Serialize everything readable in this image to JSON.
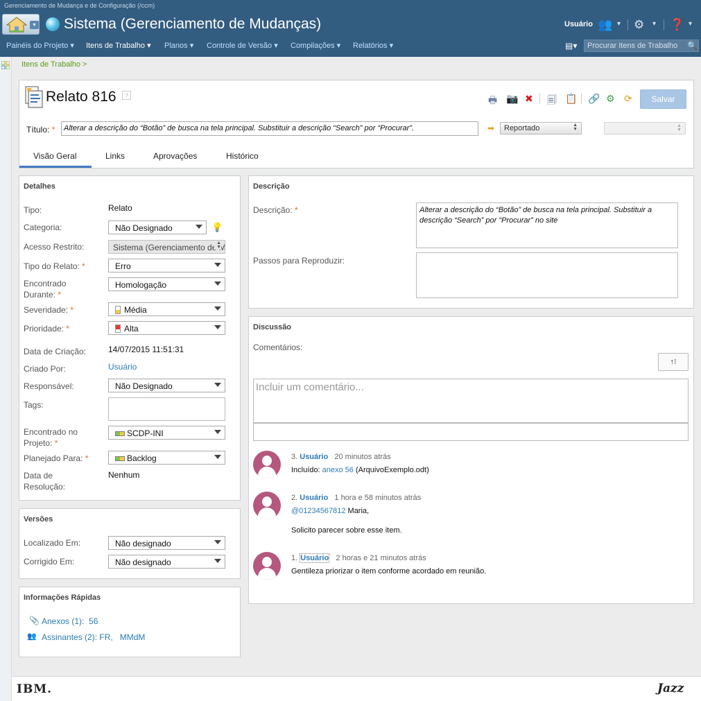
{
  "app": {
    "title": "Gerenciamento de Mudança e de Configuração (/ccm)",
    "project_title": "Sistema (Gerenciamento de Mudanças)",
    "user_label": "Usuário"
  },
  "menu": [
    {
      "label": "Painéis do Projeto"
    },
    {
      "label": "Itens de Trabalho"
    },
    {
      "label": "Planos"
    },
    {
      "label": "Controle de Versão"
    },
    {
      "label": "Compilações"
    },
    {
      "label": "Relatórios"
    }
  ],
  "search": {
    "placeholder": "Procurar Itens de Trabalho"
  },
  "breadcrumb": "Itens de Trabalho >",
  "workitem": {
    "title": "Relato 816",
    "save_label": "Salvar",
    "title_label": "Título:",
    "title_value": "Alterar a descrição do “Botão” de busca na tela principal. Substituir a descrição “Search” por “Procurar”.",
    "state": "Reportado"
  },
  "tabs": [
    {
      "label": "Visão Geral"
    },
    {
      "label": "Links"
    },
    {
      "label": "Aprovações"
    },
    {
      "label": "Histórico"
    }
  ],
  "details": {
    "heading": "Detalhes",
    "tipo_label": "Tipo:",
    "tipo": "Relato",
    "categoria_label": "Categoria:",
    "categoria": "Não Designado",
    "acesso_label": "Acesso Restrito:",
    "acesso": "Sistema (Gerenciamento de Mudanças)",
    "tipo_relato_label": "Tipo do Relato:",
    "tipo_relato": "Erro",
    "encontrado_durante_label_1": "Encontrado",
    "encontrado_durante_label_2": "Durante:",
    "encontrado_durante": "Homologação",
    "severidade_label": "Severidade:",
    "severidade": "Média",
    "prioridade_label": "Prioridade:",
    "prioridade": "Alta",
    "data_criacao_label": "Data de Criação:",
    "data_criacao": "14/07/2015 11:51:31",
    "criado_por_label": "Criado Por:",
    "criado_por": "Usuário",
    "responsavel_label": "Responsável:",
    "responsavel": "Não Designado",
    "tags_label": "Tags:",
    "encontrado_projeto_label_1": "Encontrado no",
    "encontrado_projeto_label_2": "Projeto:",
    "encontrado_projeto": "SCDP-INI",
    "planejado_label": "Planejado Para:",
    "planejado": "Backlog",
    "data_resolucao_label_1": "Data de",
    "data_resolucao_label_2": "Resolução:",
    "data_resolucao": "Nenhum"
  },
  "versions": {
    "heading": "Versões",
    "localizado_label": "Localizado Em:",
    "localizado": "Não designado",
    "corrigido_label": "Corrigido Em:",
    "corrigido": "Não designado"
  },
  "quickinfo": {
    "heading": "Informações Rápidas",
    "anexos_label": "Anexos (1):",
    "anexos_value": "56",
    "assinantes_label": "Assinantes (2):",
    "assinante_1": "FR,",
    "assinante_2": "MMdM"
  },
  "description": {
    "heading": "Descrição",
    "desc_label": "Descrição:",
    "desc_value": "Alterar a descrição do “Botão” de busca na tela principal. Substituir a descrição “Search” por “Procurar” no site",
    "steps_label": "Passos para Reproduzir:"
  },
  "discussion": {
    "heading": "Discussão",
    "comments_label": "Comentários:",
    "comment_placeholder": "Incluir um comentário...",
    "comments": [
      {
        "num": "3.",
        "author": "Usuário",
        "time": "20 minutos atrás",
        "prefix": "Incluído:",
        "link": "anexo 56",
        "suffix": "(ArquivoExemplo.odt)"
      },
      {
        "num": "2.",
        "author": "Usuário",
        "time": "1 hora e 58 minutos atrás",
        "mention": "@01234567812",
        "line1_rest": "Maria,",
        "line2": "Solicito parecer sobre esse item."
      },
      {
        "num": "1.",
        "author": "Usuário",
        "time": "2 horas e 21 minutos atrás",
        "text": "Gentileza priorizar o item conforme acordado em reunião."
      }
    ]
  },
  "footer": {
    "ibm": "IBM.",
    "jazz": "Jazz"
  },
  "colors": {
    "banner": "#325c80",
    "accent": "#4178be",
    "link": "#2d7bb3",
    "required": "#e86c1f",
    "avatar": "#b5577e"
  }
}
